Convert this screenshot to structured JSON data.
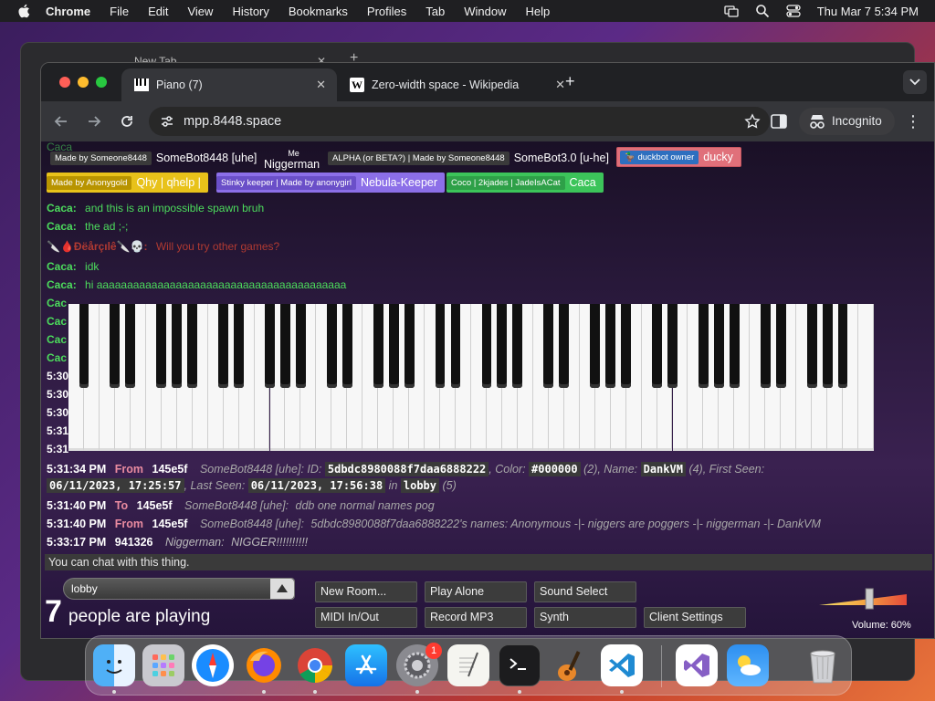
{
  "menubar": {
    "app_name": "Chrome",
    "items": [
      "File",
      "Edit",
      "View",
      "History",
      "Bookmarks",
      "Profiles",
      "Tab",
      "Window",
      "Help"
    ],
    "clock": "Thu Mar 7  5:34 PM"
  },
  "background_window": {
    "tab_title": "New Tab"
  },
  "browser": {
    "tabs": [
      {
        "title": "Piano (7)",
        "active": true
      },
      {
        "title": "Zero-width space - Wikipedia",
        "active": false
      }
    ],
    "url": "mpp.8448.space",
    "incognito_label": "Incognito"
  },
  "user_tags": [
    {
      "tag": "Made by Someone8448",
      "name": "SomeBot8448 [uhe]",
      "tag_color": "#3a3a3a",
      "name_color": "#ffffff"
    },
    {
      "tag": "Me",
      "name": "Niggerman",
      "tag_color": "",
      "name_color": "#ffffff"
    },
    {
      "tag": "ALPHA (or BETA?) | Made by Someone8448",
      "name": "SomeBot3.0 [u-he]",
      "tag_color": "#3a3a3a",
      "name_color": "#ffffff"
    },
    {
      "tag": "duckbot owner",
      "name": "ducky",
      "tag_color": "#2e6fbf",
      "name_color": "#ffffff",
      "bg": "#e0707a"
    },
    {
      "tag": "Made by Anonygold",
      "name": "Qhy | qhelp |",
      "tag_color": "#c8a000",
      "name_color": "#ffffff",
      "bg": "#e8c21a"
    },
    {
      "tag": "Stinky keeper | Made by anonygirl",
      "name": "Nebula-Keeper",
      "tag_color": "#6a4fc8",
      "name_color": "#ffffff",
      "bg": "#8c6fe8"
    },
    {
      "tag": "Coco | 2kjades | JadeIsACat",
      "name": "Caca",
      "tag_color": "#2ea048",
      "name_color": "#ffffff",
      "bg": "#3cc45a"
    }
  ],
  "upper_chat": [
    {
      "user": "Caca:",
      "msg": "and this is an impossible spawn bruh",
      "user_color": "#4cdc5c",
      "msg_color": "#4cdc5c"
    },
    {
      "user": "Caca:",
      "msg": "the ad ;-;",
      "user_color": "#4cdc5c",
      "msg_color": "#4cdc5c"
    },
    {
      "user": "🔪🩸Ðëårçılê🔪💀:",
      "msg": "Will you try other games?",
      "user_color": "#c0392b",
      "msg_color": "#c0392b"
    },
    {
      "user": "Caca:",
      "msg": "idk",
      "user_color": "#4cdc5c",
      "msg_color": "#4cdc5c"
    },
    {
      "user": "Caca:",
      "msg": "hi aaaaaaaaaaaaaaaaaaaaaaaaaaaaaaaaaaaaaaaaa",
      "user_color": "#4cdc5c",
      "msg_color": "#4cdc5c"
    }
  ],
  "left_stub_lines": [
    "Caca",
    "Cac",
    "Cac",
    "Cac",
    "Cac",
    "5:30",
    "5:30",
    "5:30",
    "5:31",
    "5:31"
  ],
  "lower_chat": {
    "line1": {
      "time": "5:31:34 PM",
      "direction": "From",
      "id": "145e5f",
      "sender": "SomeBot8448 [uhe]:",
      "text_pre": "ID: ",
      "user_id": "5dbdc8980088f7daa6888222",
      "color_label": ", Color: ",
      "color": "#000000",
      "color_count": " (2), Name: ",
      "name": "DankVM",
      "name_count": " (4), First Seen: ",
      "first_seen": "06/11/2023, 17:25:57",
      "last_seen_label": ", Last Seen: ",
      "last_seen": "06/11/2023, 17:56:38",
      "in_label": " in ",
      "room": "lobby",
      "room_count": " (5)"
    },
    "line2": {
      "time": "5:31:40 PM",
      "direction": "To",
      "id": "145e5f",
      "sender": "SomeBot8448 [uhe]:",
      "msg": "ddb one normal names pog"
    },
    "line3": {
      "time": "5:31:40 PM",
      "direction": "From",
      "id": "145e5f",
      "sender": "SomeBot8448 [uhe]:",
      "msg": "5dbdc8980088f7daa6888222's names: Anonymous -|- niggers are poggers -|- niggerman -|- DankVM"
    },
    "line4": {
      "time": "5:33:17 PM",
      "id": "941326",
      "sender": "Niggerman:",
      "msg": "NIGGER!!!!!!!!!!"
    }
  },
  "chat_input_placeholder": "You can chat with this thing.",
  "controls": {
    "room": "lobby",
    "player_count": "7",
    "player_text": "people are playing",
    "buttons": {
      "new_room": "New Room...",
      "play_alone": "Play Alone",
      "sound_select": "Sound Select",
      "midi": "MIDI In/Out",
      "record": "Record MP3",
      "synth": "Synth",
      "client_settings": "Client Settings"
    },
    "volume_label": "Volume: 60%",
    "volume_level": 0.6
  },
  "dock": {
    "apps": [
      "finder-icon",
      "launchpad-icon",
      "safari-icon",
      "firefox-icon",
      "chrome-icon",
      "app-store-icon",
      "system-settings-icon",
      "textedit-icon",
      "terminal-icon",
      "garageband-icon",
      "vscode-icon",
      "visual-studio-icon",
      "weather-icon",
      "trash-icon"
    ],
    "settings_badge": "1"
  }
}
